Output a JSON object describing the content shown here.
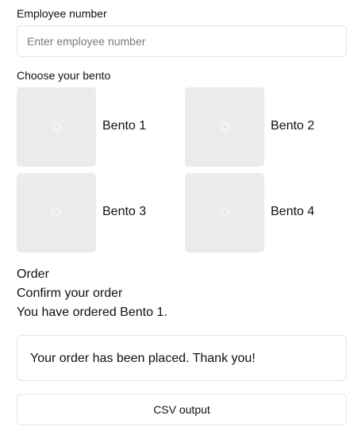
{
  "employee": {
    "label": "Employee number",
    "placeholder": "Enter employee number",
    "value": ""
  },
  "bento": {
    "label": "Choose your bento",
    "options": [
      {
        "label": "Bento 1",
        "image_icon": "image-placeholder-icon"
      },
      {
        "label": "Bento 2",
        "image_icon": "image-placeholder-icon"
      },
      {
        "label": "Bento 3",
        "image_icon": "image-placeholder-icon"
      },
      {
        "label": "Bento 4",
        "image_icon": "image-placeholder-icon"
      }
    ]
  },
  "order": {
    "heading": "Order",
    "subheading": "Confirm your order",
    "status": "You have ordered Bento 1.",
    "message": "Your order has been placed. Thank you!"
  },
  "actions": {
    "csv_label": "CSV output"
  },
  "colors": {
    "border": "#e3e3e3",
    "placeholder_bg": "#ebebeb",
    "text": "#111111"
  }
}
